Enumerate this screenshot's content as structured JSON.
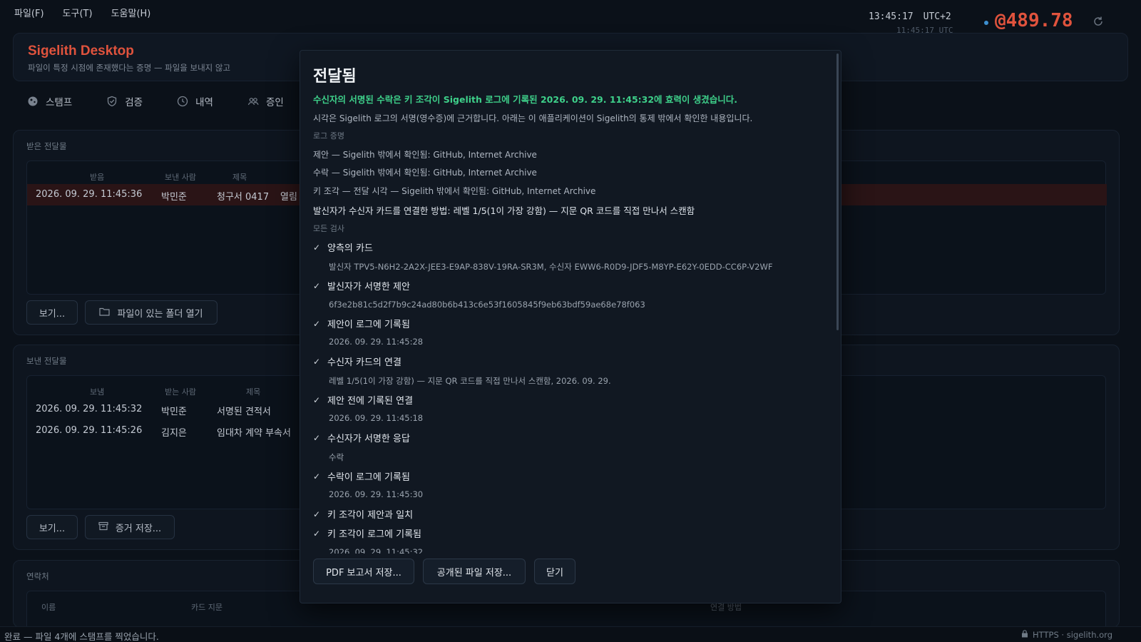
{
  "menu": [
    "파일(F)",
    "도구(T)",
    "도움말(H)"
  ],
  "header": {
    "title": "Sigelith Desktop",
    "subtitle": "파일이 특정 시점에 존재했다는 증명 — 파일을 보내지 않고",
    "time": "13:45:17",
    "tz": "UTC+2",
    "utc_time": "11:45:17 UTC",
    "balance": "@489.78"
  },
  "tabs": [
    {
      "label": "스탬프",
      "icon": "stamp-icon"
    },
    {
      "label": "검증",
      "icon": "shield-icon"
    },
    {
      "label": "내역",
      "icon": "clock-icon"
    },
    {
      "label": "증인",
      "icon": "people-icon"
    }
  ],
  "received": {
    "title": "받은 전달물",
    "headers": [
      "받음",
      "보낸 사람",
      "제목"
    ],
    "rows": [
      {
        "date": "2026. 09. 29. 11:45:36",
        "person": "박민준",
        "subject": "청구서 0417",
        "status": "열림"
      }
    ],
    "view_button": "보기...",
    "open_folder_button": "파일이 있는 폴더 열기"
  },
  "sent": {
    "title": "보낸 전달물",
    "headers": [
      "보냄",
      "받는 사람",
      "제목"
    ],
    "rows": [
      {
        "date": "2026. 09. 29. 11:45:32",
        "person": "박민준",
        "subject": "서명된 견적서"
      },
      {
        "date": "2026. 09. 29. 11:45:26",
        "person": "김지은",
        "subject": "임대차 계약 부속서"
      }
    ],
    "view_button": "보기...",
    "save_evidence_button": "증거 저장..."
  },
  "contacts": {
    "title": "연락처",
    "headers": [
      "이름",
      "카드 지문",
      "연결 방법"
    ]
  },
  "modal": {
    "title": "전달됨",
    "headline": "수신자의 서명된 수락은 키 조각이 Sigelith 로그에 기록된 2026. 09. 29. 11:45:32에 효력이 생겼습니다.",
    "note": "시각은 Sigelith 로그의 서명(영수증)에 근거합니다. 아래는 이 애플리케이션이 Sigelith의 통제 밖에서 확인한 내용입니다.",
    "log_proof_label": "로그 증명",
    "log_proofs": [
      "제안 — Sigelith 밖에서 확인됨: GitHub, Internet Archive",
      "수락 — Sigelith 밖에서 확인됨: GitHub, Internet Archive",
      "키 조각 — 전달 시각 — Sigelith 밖에서 확인됨: GitHub, Internet Archive"
    ],
    "link_method": "발신자가 수신자 카드를 연결한 방법: 레벨 1/5(1이 가장 강함) — 지문 QR 코드를 직접 만나서 스캔함",
    "all_checks_label": "모든 검사",
    "checks": [
      {
        "label": "양측의 카드",
        "detail": "발신자 TPV5-N6H2-2A2X-JEE3-E9AP-838V-19RA-SR3M, 수신자 EWW6-R0D9-JDF5-M8YP-E62Y-0EDD-CC6P-V2WF"
      },
      {
        "label": "발신자가 서명한 제안",
        "detail": "6f3e2b81c5d2f7b9c24ad80b6b413c6e53f1605845f9eb63bdf59ae68e78f063"
      },
      {
        "label": "제안이 로그에 기록됨",
        "detail": "2026. 09. 29. 11:45:28"
      },
      {
        "label": "수신자 카드의 연결",
        "detail": "레벨 1/5(1이 가장 강함) — 지문 QR 코드를 직접 만나서 스캔함, 2026. 09. 29."
      },
      {
        "label": "제안 전에 기록된 연결",
        "detail": "2026. 09. 29. 11:45:18"
      },
      {
        "label": "수신자가 서명한 응답",
        "detail": "수락"
      },
      {
        "label": "수락이 로그에 기록됨",
        "detail": "2026. 09. 29. 11:45:30"
      },
      {
        "label": "키 조각이 제안과 일치",
        "detail": ""
      },
      {
        "label": "키 조각이 로그에 기록됨",
        "detail": "2026. 09. 29. 11:45:32"
      }
    ],
    "buttons": {
      "save_pdf": "PDF 보고서 저장...",
      "save_public": "공개된 파일 저장...",
      "close": "닫기"
    }
  },
  "status": {
    "text": "완료 — 파일 4개에 스탬프를 찍었습니다.",
    "secure": "HTTPS · sigelith.org"
  }
}
